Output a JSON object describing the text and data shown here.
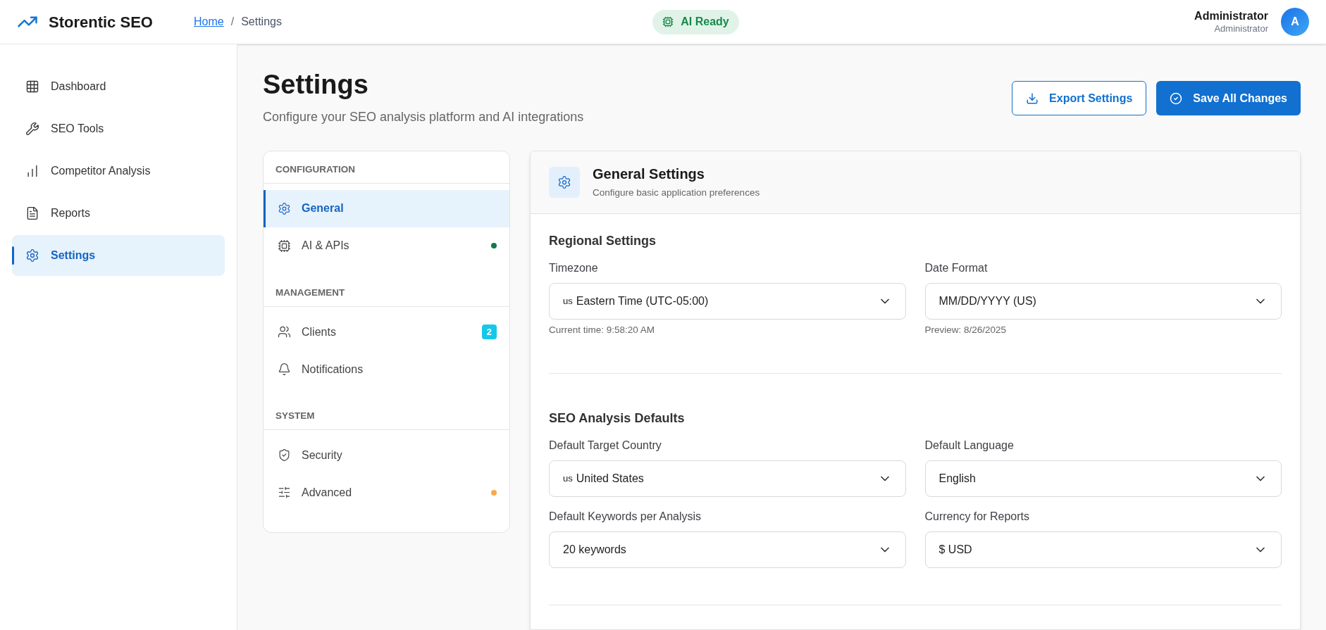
{
  "header": {
    "brand": "Storentic SEO",
    "breadcrumb": [
      {
        "label": "Home",
        "kind": "link"
      },
      {
        "label": "/",
        "kind": "separator"
      },
      {
        "label": "Settings",
        "kind": "current"
      }
    ],
    "status": "AI Ready",
    "user": {
      "name": "Administrator",
      "role": "Administrator",
      "initial": "A"
    }
  },
  "sidebar": {
    "items": [
      {
        "label": "Dashboard",
        "selected": false
      },
      {
        "label": "SEO Tools",
        "selected": false
      },
      {
        "label": "Competitor Analysis",
        "selected": false
      },
      {
        "label": "Reports",
        "selected": false
      },
      {
        "label": "Settings",
        "selected": true
      }
    ]
  },
  "page": {
    "title": "Settings",
    "subtitle": "Configure your SEO analysis platform and AI integrations",
    "buttons": [
      {
        "label": "Export Settings",
        "kind": "secondary"
      },
      {
        "label": "Save All Changes",
        "kind": "primary"
      }
    ]
  },
  "settings_nav": {
    "groups": [
      {
        "title": "CONFIGURATION",
        "items": [
          {
            "label": "General",
            "selected": true
          },
          {
            "label": "AI & APIs",
            "selected": false,
            "color": "#0f7b4a"
          }
        ]
      },
      {
        "title": "MANAGEMENT",
        "items": [
          {
            "label": "Clients",
            "selected": false,
            "badge": "2"
          },
          {
            "label": "Notifications",
            "selected": false
          }
        ]
      },
      {
        "title": "SYSTEM",
        "items": [
          {
            "label": "Security",
            "selected": false
          },
          {
            "label": "Advanced",
            "selected": false,
            "color": "#f9a94a"
          }
        ]
      }
    ]
  },
  "panel": {
    "title": "General Settings",
    "subtitle": "Configure basic application preferences",
    "sections": [
      {
        "title": "Regional Settings",
        "fields": [
          {
            "label": "Timezone",
            "flag": "us",
            "value": "Eastern Time (UTC-05:00)",
            "hint": "Current time: 9:58:20 AM"
          },
          {
            "label": "Date Format",
            "value": "MM/DD/YYYY (US)",
            "hint": "Preview: 8/26/2025"
          }
        ]
      },
      {
        "title": "SEO Analysis Defaults",
        "fields": [
          {
            "label": "Default Target Country",
            "flag": "us",
            "value": "United States"
          },
          {
            "label": "Default Language",
            "value": "English"
          },
          {
            "label": "Default Keywords per Analysis",
            "value": "20 keywords"
          },
          {
            "label": "Currency for Reports",
            "value": "$ USD"
          }
        ]
      }
    ]
  }
}
